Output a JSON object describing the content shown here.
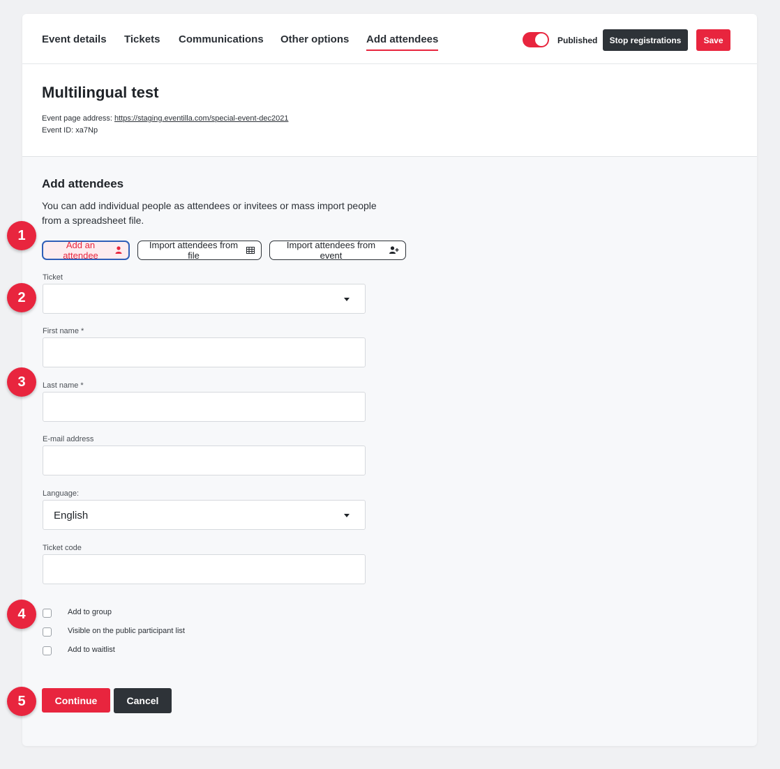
{
  "tabs": [
    {
      "label": "Event details"
    },
    {
      "label": "Tickets"
    },
    {
      "label": "Communications"
    },
    {
      "label": "Other options"
    },
    {
      "label": "Add attendees",
      "active": true
    }
  ],
  "header": {
    "published_label": "Published",
    "published_on": true,
    "stop_label": "Stop registrations",
    "save_label": "Save"
  },
  "event": {
    "title": "Multilingual test",
    "address_prefix": "Event page address: ",
    "address_url": "https://staging.eventilla.com/special-event-dec2021",
    "id_line": "Event ID: xa7Np"
  },
  "section": {
    "title": "Add attendees",
    "description": "You can add individual people as attendees or invitees or mass import people from a spreadsheet file."
  },
  "options": {
    "add_attendee": "Add an attendee",
    "import_file": "Import attendees from file",
    "import_event": "Import attendees from event"
  },
  "form": {
    "ticket_label": "Ticket",
    "ticket_value": "",
    "first_name_label": "First name *",
    "first_name_value": "",
    "last_name_label": "Last name *",
    "last_name_value": "",
    "email_label": "E-mail address",
    "email_value": "",
    "language_label": "Language:",
    "language_value": "English",
    "ticket_code_label": "Ticket code",
    "ticket_code_value": ""
  },
  "checkboxes": [
    {
      "label": "Add to group",
      "checked": false
    },
    {
      "label": "Visible on the public participant list",
      "checked": false
    },
    {
      "label": "Add to waitlist",
      "checked": false
    }
  ],
  "actions": {
    "continue_label": "Continue",
    "cancel_label": "Cancel"
  },
  "steps": [
    "1",
    "2",
    "3",
    "4",
    "5"
  ],
  "colors": {
    "accent": "#e8253e",
    "dark": "#2e3338",
    "focus": "#2f5fb8"
  },
  "icons": {
    "add_attendee": "user-icon",
    "import_file": "table-icon",
    "import_event": "user-plus-icon",
    "select": "caret-down-icon"
  }
}
